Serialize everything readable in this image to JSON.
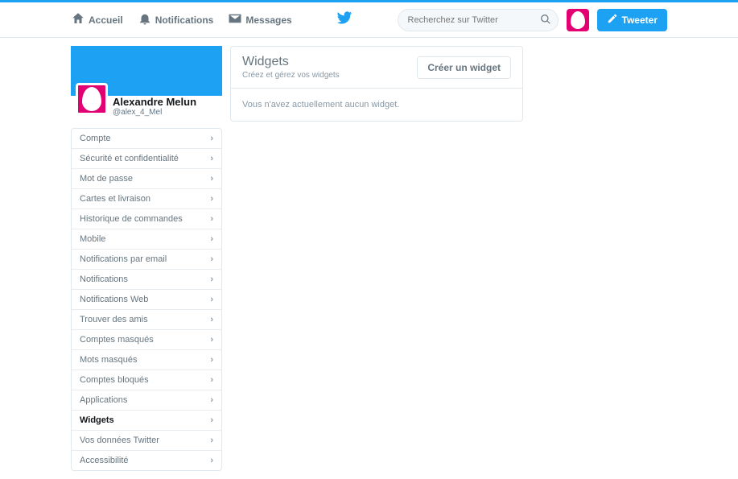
{
  "nav": {
    "home": "Accueil",
    "notifications": "Notifications",
    "messages": "Messages"
  },
  "search": {
    "placeholder": "Recherchez sur Twitter"
  },
  "compose": {
    "label": "Tweeter"
  },
  "profile": {
    "name": "Alexandre Melun",
    "handle": "@alex_4_Mel"
  },
  "sidebar": {
    "items": [
      {
        "label": "Compte",
        "active": false
      },
      {
        "label": "Sécurité et confidentialité",
        "active": false
      },
      {
        "label": "Mot de passe",
        "active": false
      },
      {
        "label": "Cartes et livraison",
        "active": false
      },
      {
        "label": "Historique de commandes",
        "active": false
      },
      {
        "label": "Mobile",
        "active": false
      },
      {
        "label": "Notifications par email",
        "active": false
      },
      {
        "label": "Notifications",
        "active": false
      },
      {
        "label": "Notifications Web",
        "active": false
      },
      {
        "label": "Trouver des amis",
        "active": false
      },
      {
        "label": "Comptes masqués",
        "active": false
      },
      {
        "label": "Mots masqués",
        "active": false
      },
      {
        "label": "Comptes bloqués",
        "active": false
      },
      {
        "label": "Applications",
        "active": false
      },
      {
        "label": "Widgets",
        "active": true
      },
      {
        "label": "Vos données Twitter",
        "active": false
      },
      {
        "label": "Accessibilité",
        "active": false
      }
    ]
  },
  "main": {
    "title": "Widgets",
    "subtitle": "Créez et gérez vos widgets",
    "create_button": "Créer un widget",
    "empty_message": "Vous n'avez actuellement aucun widget."
  }
}
